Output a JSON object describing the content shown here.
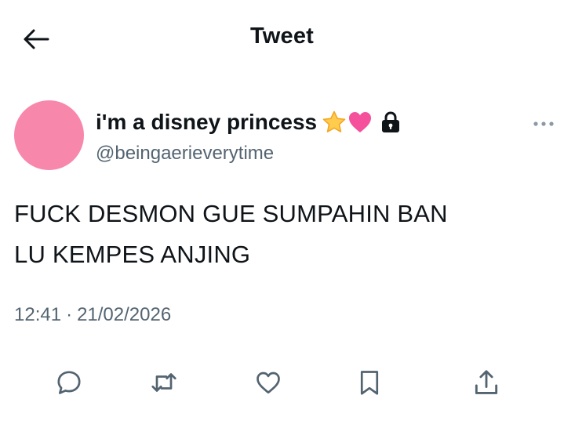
{
  "header": {
    "title": "Tweet"
  },
  "author": {
    "display_name": "i'm a disney princess",
    "name_emojis": [
      "star-emoji",
      "pink-heart-emoji"
    ],
    "protected": true,
    "handle": "@beingaerieverytime",
    "avatar_color": "#f887ac"
  },
  "tweet": {
    "text": "FUCK DESMON GUE SUMPAHIN BAN\nLU KEMPES ANJING",
    "time": "12:41",
    "separator": "·",
    "date": "21/02/2026"
  },
  "actions": [
    {
      "name": "reply",
      "icon": "reply-icon"
    },
    {
      "name": "retweet",
      "icon": "retweet-icon"
    },
    {
      "name": "like",
      "icon": "heart-icon"
    },
    {
      "name": "bookmark",
      "icon": "bookmark-icon"
    },
    {
      "name": "share",
      "icon": "share-icon"
    }
  ],
  "colors": {
    "text_primary": "#0f1419",
    "text_secondary": "#536471",
    "icon": "#536471",
    "background": "#ffffff"
  }
}
